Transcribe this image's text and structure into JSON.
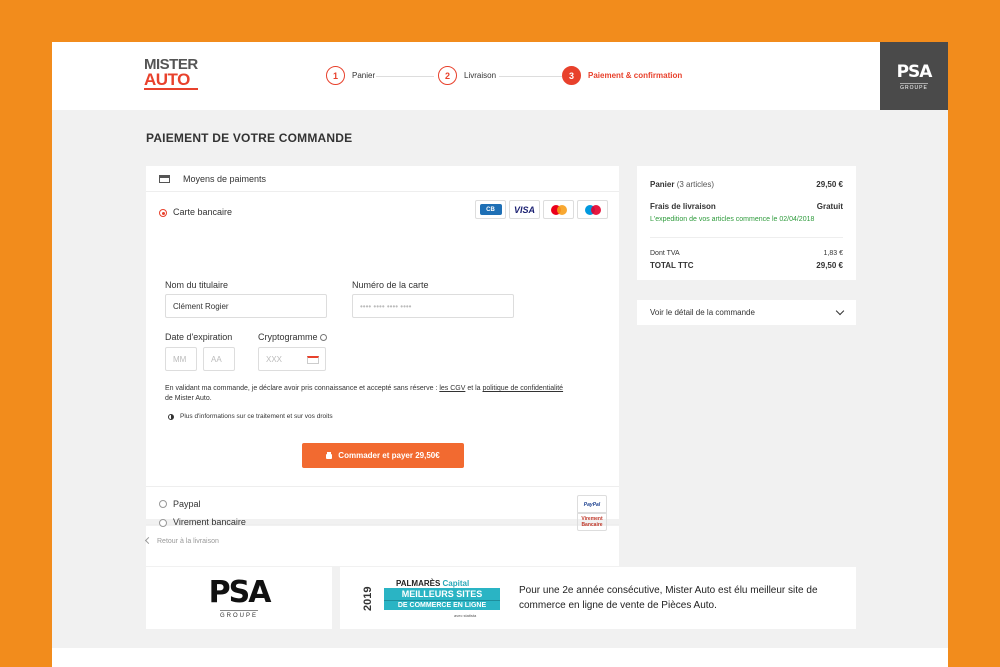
{
  "header": {
    "logo_line1": "MISTER",
    "logo_line2": "AUTO",
    "steps": [
      {
        "num": "1",
        "label": "Panier"
      },
      {
        "num": "2",
        "label": "Livraison"
      },
      {
        "num": "3",
        "label": "Paiement & confirmation"
      }
    ],
    "partner_badge": {
      "title": "PSA",
      "subtitle": "GROUPE"
    }
  },
  "page_title": "PAIEMENT DE VOTRE COMMANDE",
  "payment": {
    "section_title": "Moyens de paiments",
    "card_option": "Carte bancaire",
    "card_logos": [
      "CB",
      "VISA",
      "Mastercard",
      "Maestro"
    ],
    "holder_label": "Nom du titulaire",
    "holder_value": "Clément Rogier",
    "number_label": "Numéro de la carte",
    "number_placeholder": "•••• •••• •••• ••••",
    "expiry_label": "Date d'expiration",
    "expiry_month_placeholder": "MM",
    "expiry_year_placeholder": "AA",
    "cvv_label": "Cryptogramme",
    "cvv_placeholder": "XXX",
    "legal_prefix": "En validant ma commande, je déclare avoir pris connaissance et accepté sans réserve : ",
    "legal_cgv": "les CGV",
    "legal_and": " et la ",
    "legal_policy": "politique de confidentialité",
    "legal_suffix": " de Mister Auto.",
    "info_text": "Plus d'informations sur ce traitement et sur vos droits",
    "pay_button": "Commader et payer 29,50€",
    "paypal_option": "Paypal",
    "paypal_logo": "PayPal",
    "transfer_option": "Virement bancaire",
    "transfer_logo": "Virement Bancaire"
  },
  "summary": {
    "cart_label": "Panier",
    "cart_count": "(3 articles)",
    "cart_amount": "29,50 €",
    "shipping_label": "Frais de livraison",
    "shipping_value": "Gratuit",
    "shipping_note": "L'expedition de vos articles commence le 02/04/2018",
    "tva_label": "Dont TVA",
    "tva_value": "1,83 €",
    "total_label": "TOTAL TTC",
    "total_value": "29,50 €",
    "detail_link": "Voir le détail de la commande"
  },
  "back_link": "Retour à la livraison",
  "promo": {
    "psa_title": "PSA",
    "psa_subtitle": "GROUPE",
    "award_year": "2019",
    "award_line1a": "PALMARÈS ",
    "award_line1b": "Capital",
    "award_line2": "MEILLEURS SITES",
    "award_line3": "DE COMMERCE EN LIGNE",
    "award_credit": "avec statista",
    "award_text": "Pour une 2e année consécutive, Mister Auto est élu meilleur site de commerce en ligne de vente de Pièces Auto."
  },
  "colors": {
    "brand": "#e8412c",
    "cta": "#f26a30",
    "background": "#f28c1c",
    "success": "#2e9b3c"
  }
}
